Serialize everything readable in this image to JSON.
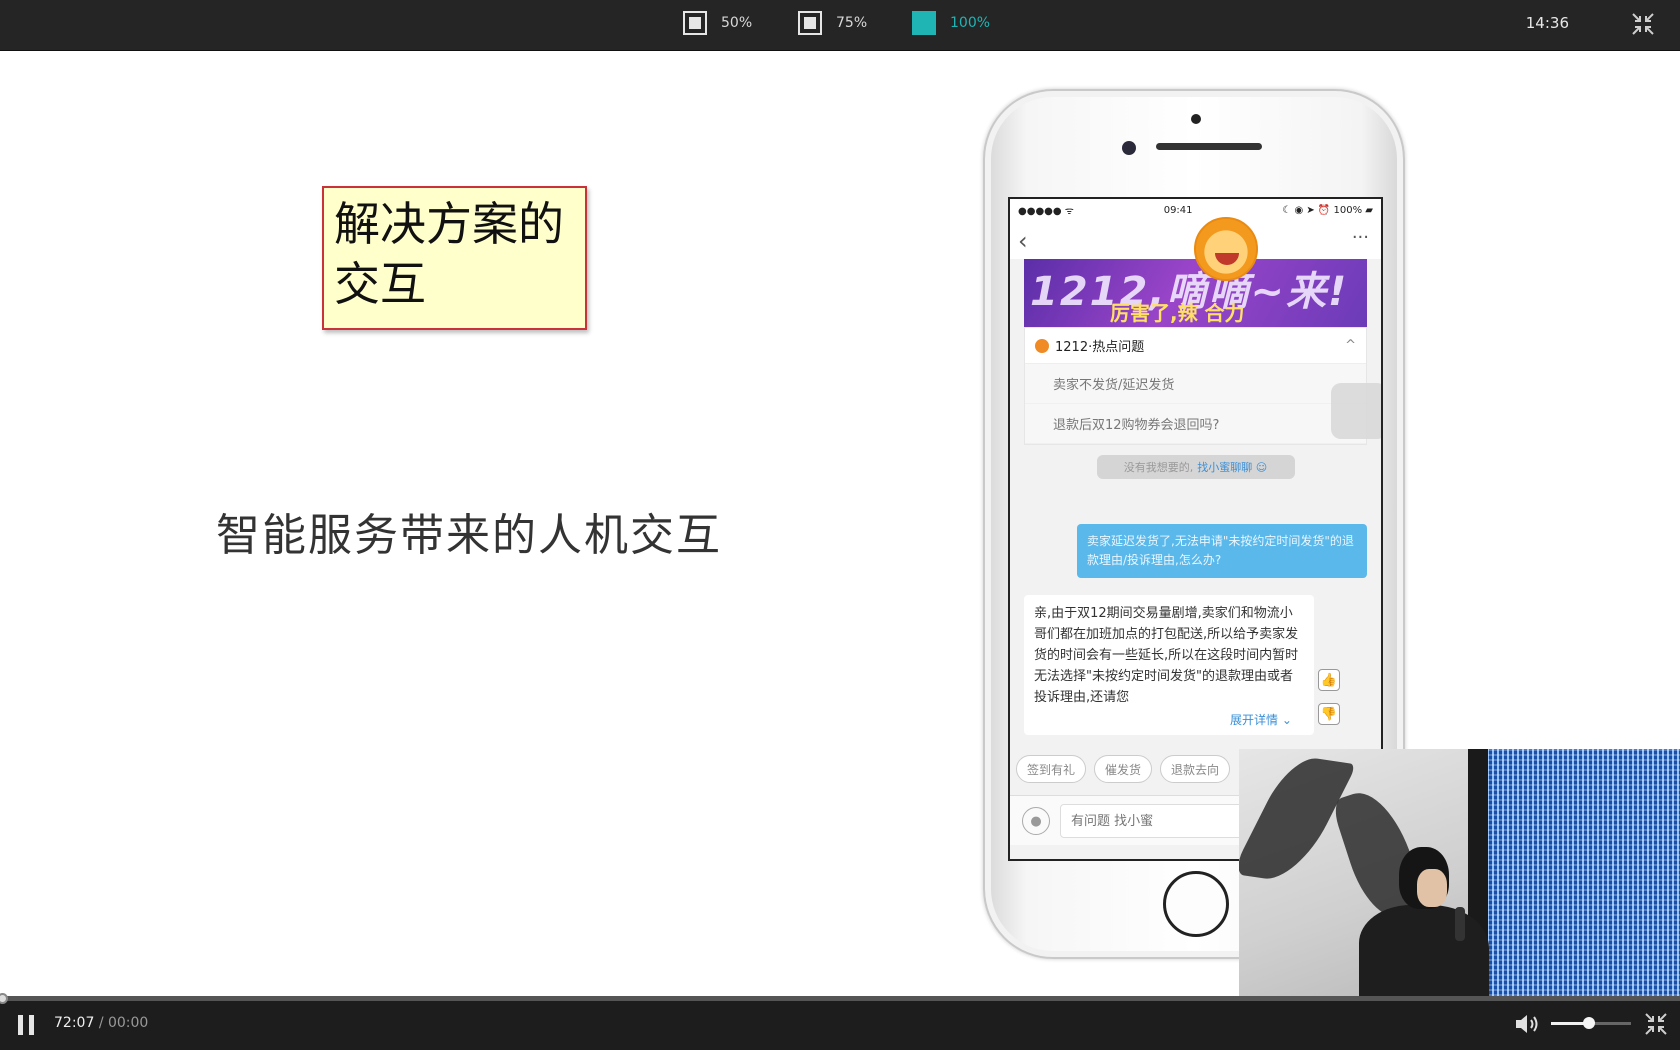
{
  "topbar": {
    "zoom_options": [
      {
        "label": "50%",
        "active": false
      },
      {
        "label": "75%",
        "active": false
      },
      {
        "label": "100%",
        "active": true
      }
    ],
    "clock": "14:36",
    "exit_icon": "exit-fullscreen-icon"
  },
  "slide": {
    "note_line1": "解决方案的",
    "note_line2": "交互",
    "title": "智能服务带来的人机交互"
  },
  "phone": {
    "status": {
      "signal": "●●●●● ᯤ",
      "time": "09:41",
      "right": "☾ ◉ ➤ ⏰ 100% ▰"
    },
    "nav": {
      "back": "‹",
      "more": "···"
    },
    "banner": {
      "big": "1212,嘀嘀~来!",
      "small": "厉害了,辣 合力"
    },
    "faq": {
      "title": "1212·热点问题",
      "chevron": "^",
      "items": [
        "卖家不发货/延迟发货",
        "退款后双12购物券会退回吗?"
      ]
    },
    "helper": {
      "text": "没有我想要的,",
      "link": "找小蜜聊聊 ☺"
    },
    "user_message": "卖家延迟发货了,无法申请\"未按约定时间发货\"的退款理由/投诉理由,怎么办?",
    "bot_message": "亲,由于双12期间交易量剧增,卖家们和物流小哥们都在加班加点的打包配送,所以给予卖家发货的时间会有一些延长,所以在这段时间内暂时无法选择\"未按约定时间发货\"的退款理由或者投诉理由,还请您",
    "expand_label": "展开详情 ⌄",
    "thumb_up": "👍",
    "thumb_down": "👎",
    "chips": [
      "签到有礼",
      "催发货",
      "退款去向"
    ],
    "input_placeholder": "有问题 找小蜜",
    "mic_icon": "microphone-icon"
  },
  "player": {
    "current_time": "72:07",
    "separator": "/",
    "duration": "00:00",
    "progress_fraction": 0.0,
    "volume_fraction": 0.47,
    "play_state": "playing"
  },
  "colors": {
    "accent": "#1fb5b5",
    "topbar_bg": "#252525",
    "note_bg": "#ffffcc",
    "note_border": "#c8323a",
    "user_bubble": "#5ab8ea"
  }
}
